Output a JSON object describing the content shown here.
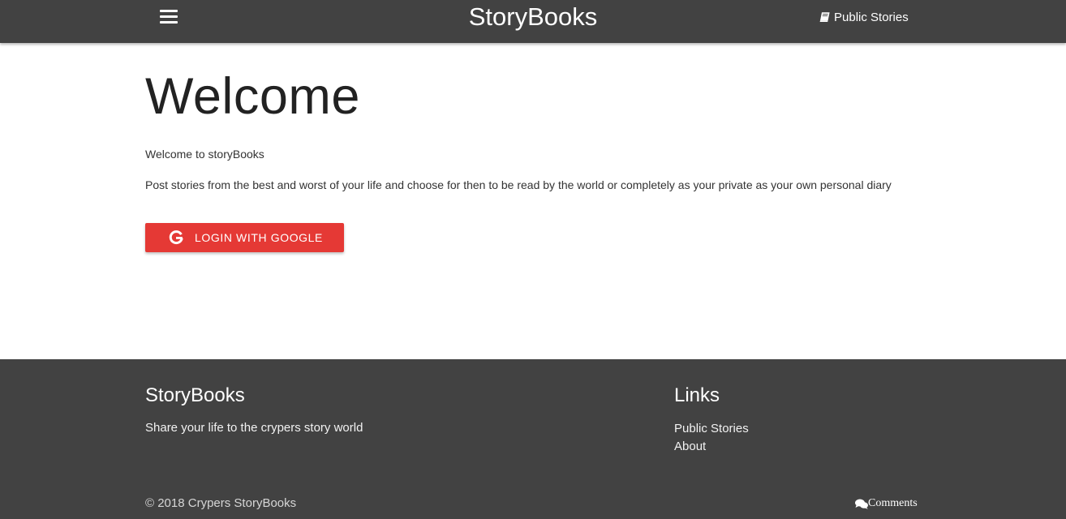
{
  "navbar": {
    "brand": "StoryBooks",
    "menu_icon": "hamburger-menu-icon",
    "public_stories_icon": "book-icon",
    "public_stories_label": "Public Stories"
  },
  "main": {
    "title": "Welcome",
    "intro": "Welcome to storyBooks",
    "description": "Post stories from the best and worst of your life and choose for then to be read by the world or completely as your private as your own personal diary",
    "login_button": {
      "icon": "google-icon",
      "label": "LOGIN WITH GOOGLE"
    }
  },
  "footer": {
    "brand_title": "StoryBooks",
    "tagline": "Share your life to the crypers story world",
    "links_title": "Links",
    "links": [
      {
        "label": "Public Stories"
      },
      {
        "label": "About"
      }
    ],
    "copyright": "© 2018 Crypers StoryBooks",
    "comments_icon": "comments-icon",
    "comments_label": "Comments"
  },
  "colors": {
    "navbar_bg": "#424242",
    "footer_bg": "#424242",
    "button_red": "#e53935",
    "body_text": "#333333",
    "heading_text": "#222222"
  }
}
